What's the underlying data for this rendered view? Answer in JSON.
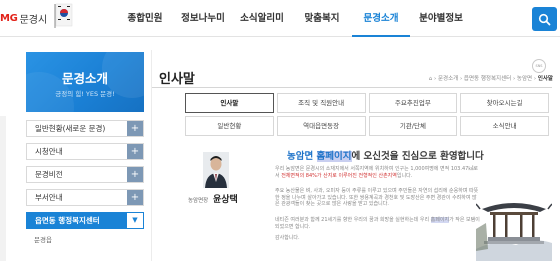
{
  "header": {
    "logo_mg": "MG",
    "logo_name": "문경시",
    "nav": [
      {
        "label": "종합민원",
        "active": false
      },
      {
        "label": "정보나누미",
        "active": false
      },
      {
        "label": "소식알리미",
        "active": false
      },
      {
        "label": "맞춤복지",
        "active": false
      },
      {
        "label": "문경소개",
        "active": true
      },
      {
        "label": "분야별정보",
        "active": false
      }
    ]
  },
  "sidebar": {
    "banner_title": "문경소개",
    "banner_sub": "긍정의 힘! YES 문경!",
    "items": [
      {
        "label": "일반현황(새로운 문경)"
      },
      {
        "label": "시청안내"
      },
      {
        "label": "문경비전"
      },
      {
        "label": "부서안내"
      },
      {
        "label": "읍면동 행정복지센터"
      }
    ],
    "sub_items": [
      "문경읍"
    ]
  },
  "content": {
    "title": "인사말",
    "sns_label": "SNS",
    "breadcrumb": [
      "문경소개",
      "읍면동 행정복지센터",
      "농암면",
      "인사말"
    ],
    "tabs": [
      [
        "인사말",
        "조직 및 직원안내",
        "주요추진업무",
        "찾아오시는길"
      ],
      [
        "일반현황",
        "역대읍면동장",
        "기관/단체",
        "소식안내"
      ]
    ],
    "greeting": {
      "photo_caption": "농암면장",
      "name": "윤상택",
      "headline_pre": "농암면 ",
      "headline_hl": "홈페이지",
      "headline_post": "에 오신것을 진심으로 환영합니다",
      "para1_a": "우리 농암면은 문경시의 소재지에서 서쪽지역에 위치하여 인구는 1,000여명에 면적 103.47㎢로서",
      "para1_red": "전체면적의 84%가 산지로 이루어진 전형적인 산촌지역",
      "para1_b": "입니다.",
      "para2": "주요 농산물은 벼, 사과, 오미자 등이 주류를 이루고 있으며 주민들은 자연의 섭리에 순응하며 따뜻한 정을 나누며 살아가고 있습니다. 또한 쌍용계곡과 경천호 및 도장산은 주변 경관이 수려하여 많은 관광객들이 찾는 곳으로 많은 사랑을 받고 있습니다.",
      "para3_a": "네티즌 여러분과 함께 21세기를 향한 우리의 꿈과 희망을 실현하는데 우리",
      "para3_hl": "홈페이지",
      "para3_b": "가 작은 보탬이 되었으면 합니다.",
      "para4": "감사합니다."
    }
  },
  "colors": {
    "accent": "#1a83d6",
    "brand_red": "#e2231a",
    "highlight": "#c9cff0",
    "emphasis_red": "#d13434"
  }
}
